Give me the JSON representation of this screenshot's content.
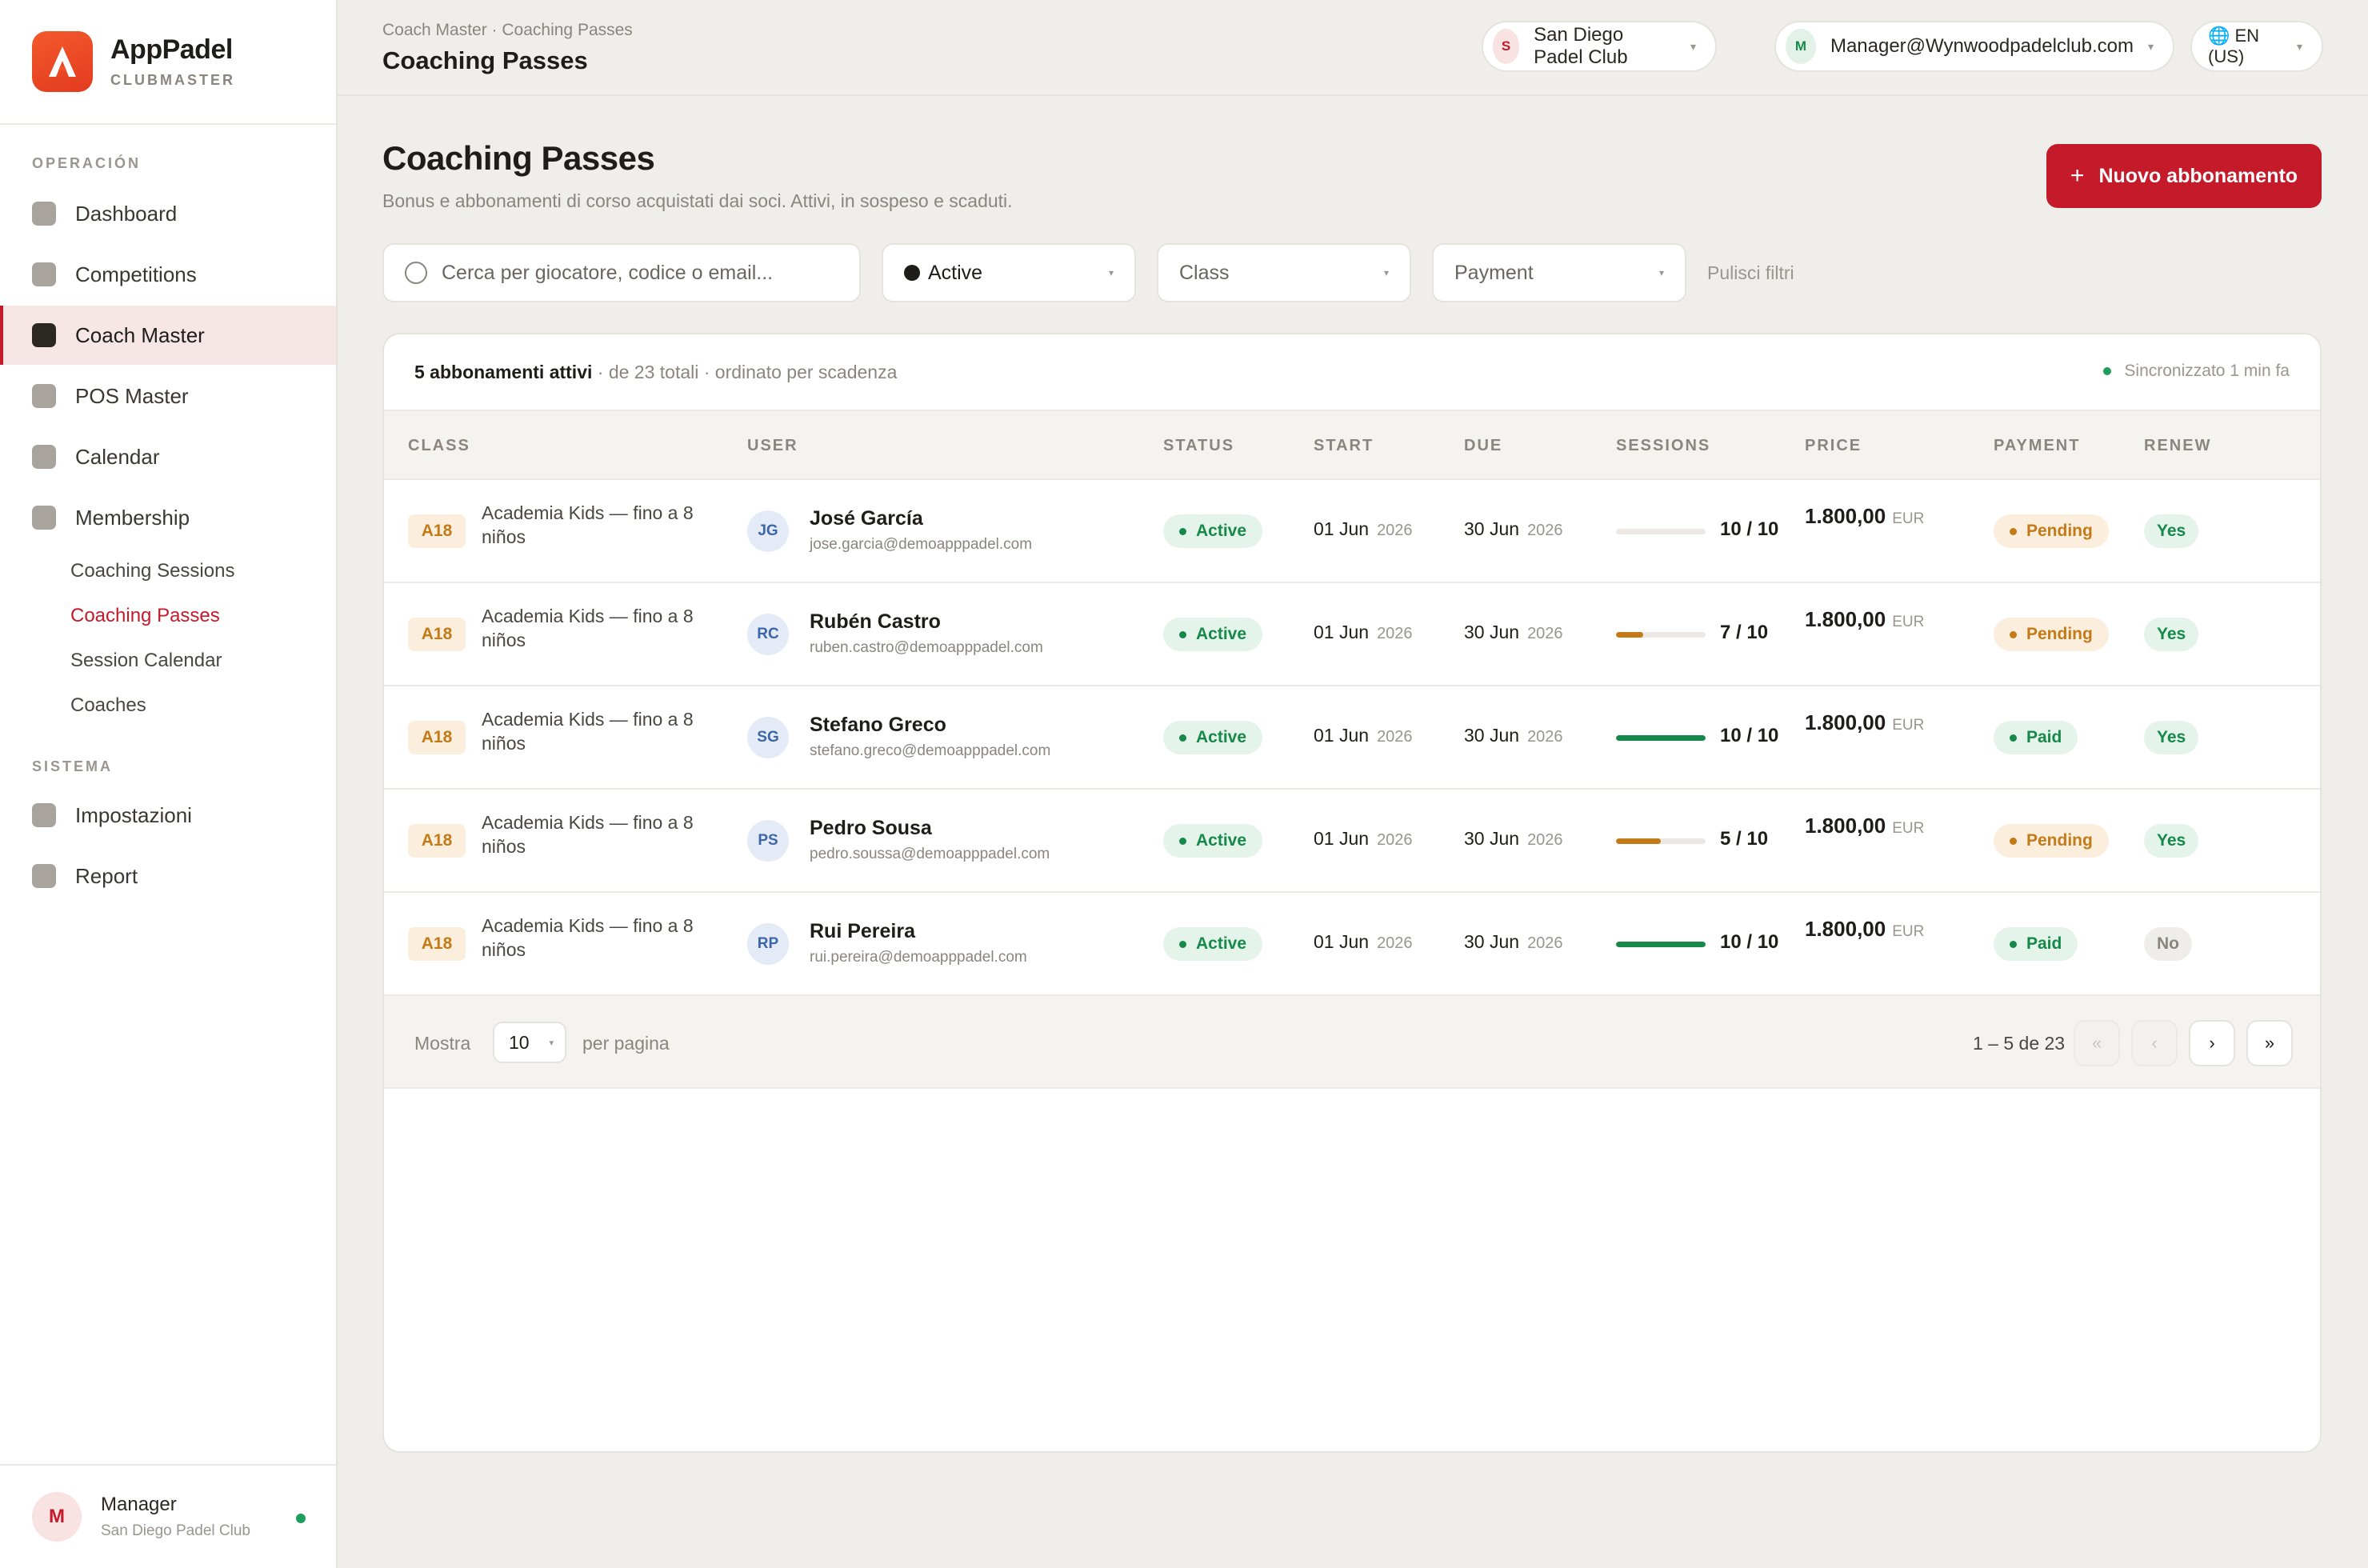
{
  "brand": {
    "name": "AppPadel",
    "subtitle": "CLUBMASTER"
  },
  "sidebar": {
    "section_operations": "OPERACIÓN",
    "section_system": "SISTEMA",
    "items": [
      {
        "label": "Dashboard"
      },
      {
        "label": "Competitions"
      },
      {
        "label": "Coach Master"
      },
      {
        "label": "POS Master"
      },
      {
        "label": "Calendar"
      },
      {
        "label": "Membership"
      }
    ],
    "subitems": [
      {
        "label": "Coaching Sessions"
      },
      {
        "label": "Coaching Passes"
      },
      {
        "label": "Session Calendar"
      },
      {
        "label": "Coaches"
      }
    ],
    "system_items": [
      {
        "label": "Impostazioni"
      },
      {
        "label": "Report"
      }
    ],
    "user": {
      "initial": "M",
      "name": "Manager",
      "club": "San Diego Padel Club"
    }
  },
  "topbar": {
    "breadcrumb": "Coach Master · Coaching Passes",
    "title": "Coaching Passes",
    "club": {
      "initial": "S",
      "label": "San Diego Padel Club"
    },
    "account": {
      "initial": "M",
      "label": "Manager@Wynwoodpadelclub.com"
    },
    "language": {
      "icon": "globe-icon",
      "label": "🌐 EN (US)"
    }
  },
  "page": {
    "title": "Coaching Passes",
    "subtitle": "Bonus e abbonamenti di corso acquistati dai soci. Attivi, in sospeso e scaduti.",
    "new_button": "Nuovo abbonamento",
    "new_button_icon": "+"
  },
  "filters": {
    "search_placeholder": "Cerca per giocatore, codice o email...",
    "status_value": "Active",
    "class_value": "Class",
    "payment_value": "Payment",
    "clear_label": "Pulisci filtri"
  },
  "table": {
    "summary_bold": "5 abbonamenti attivi",
    "summary_rest": " · de 23 totali · ordinato per scadenza",
    "sync_label": "Sincronizzato 1 min fa",
    "columns": [
      "CLASS",
      "USER",
      "STATUS",
      "START",
      "DUE",
      "SESSIONS",
      "PRICE",
      "PAYMENT",
      "RENEW"
    ],
    "rows": [
      {
        "class_code": "A18",
        "class_name": "Academia Kids — fino a 8 niños",
        "initials": "JG",
        "name": "José García",
        "email": "jose.garcia@demoapppadel.com",
        "status": "Active",
        "start": "01 Jun",
        "start_year": "2026",
        "due": "30 Jun",
        "due_year": "2026",
        "sessions": "10 / 10",
        "progress": 0,
        "price": "1.800,00",
        "currency": "EUR",
        "payment": "Pending",
        "renew": "Yes"
      },
      {
        "class_code": "A18",
        "class_name": "Academia Kids — fino a 8 niños",
        "initials": "RC",
        "name": "Rubén Castro",
        "email": "ruben.castro@demoapppadel.com",
        "status": "Active",
        "start": "01 Jun",
        "start_year": "2026",
        "due": "30 Jun",
        "due_year": "2026",
        "sessions": "7 / 10",
        "progress": 0.3,
        "price": "1.800,00",
        "currency": "EUR",
        "payment": "Pending",
        "renew": "Yes"
      },
      {
        "class_code": "A18",
        "class_name": "Academia Kids — fino a 8 niños",
        "initials": "SG",
        "name": "Stefano Greco",
        "email": "stefano.greco@demoapppadel.com",
        "status": "Active",
        "start": "01 Jun",
        "start_year": "2026",
        "due": "30 Jun",
        "due_year": "2026",
        "sessions": "10 / 10",
        "progress": 1,
        "price": "1.800,00",
        "currency": "EUR",
        "payment": "Paid",
        "renew": "Yes"
      },
      {
        "class_code": "A18",
        "class_name": "Academia Kids — fino a 8 niños",
        "initials": "PS",
        "name": "Pedro Sousa",
        "email": "pedro.soussa@demoapppadel.com",
        "status": "Active",
        "start": "01 Jun",
        "start_year": "2026",
        "due": "30 Jun",
        "due_year": "2026",
        "sessions": "5 / 10",
        "progress": 0.5,
        "price": "1.800,00",
        "currency": "EUR",
        "payment": "Pending",
        "renew": "Yes"
      },
      {
        "class_code": "A18",
        "class_name": "Academia Kids — fino a 8 niños",
        "initials": "RP",
        "name": "Rui Pereira",
        "email": "rui.pereira@demoapppadel.com",
        "status": "Active",
        "start": "01 Jun",
        "start_year": "2026",
        "due": "30 Jun",
        "due_year": "2026",
        "sessions": "10 / 10",
        "progress": 1,
        "price": "1.800,00",
        "currency": "EUR",
        "payment": "Paid",
        "renew": "No"
      }
    ]
  },
  "pagination": {
    "show_label": "Mostra",
    "per_page": "10",
    "per_page_label": "per pagina",
    "range": "1 – 5 de 23",
    "first": "«",
    "prev": "‹",
    "next": "›",
    "last": "»"
  },
  "colors": {
    "accent": "#c41a2a",
    "success": "#16894a",
    "warning": "#c37a18"
  }
}
